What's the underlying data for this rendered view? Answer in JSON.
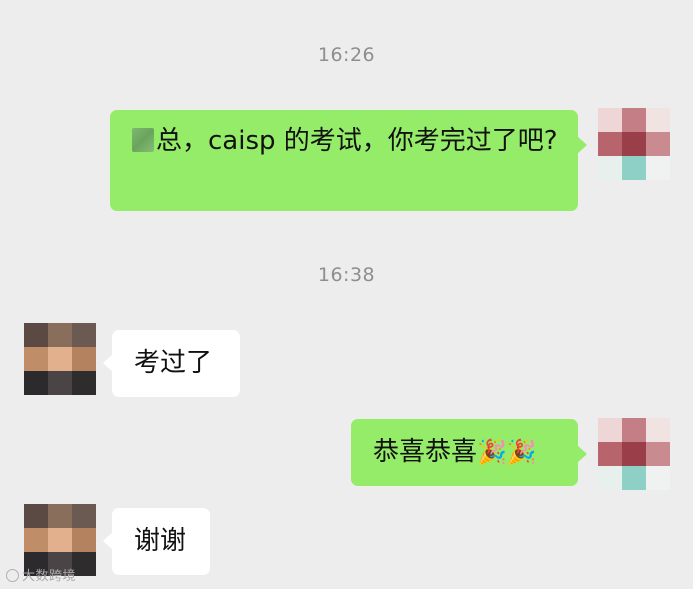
{
  "messages": [
    {
      "type": "time",
      "text": "16:26"
    },
    {
      "type": "outgoing",
      "redacted_prefix": true,
      "text": "总，caisp 的考试，你考完过了吧?"
    },
    {
      "type": "time",
      "text": "16:38"
    },
    {
      "type": "incoming",
      "text": "考过了"
    },
    {
      "type": "outgoing",
      "text": "恭喜恭喜",
      "emoji": "🎉🎉",
      "emoji_names": [
        "party-popper-icon",
        "party-popper-icon"
      ]
    },
    {
      "type": "incoming",
      "text": "谢谢"
    }
  ],
  "watermark": {
    "text": "大数跨境",
    "icon": "watermark-logo-icon"
  },
  "colors": {
    "background": "#ededed",
    "outgoing_bubble": "#95ec69",
    "incoming_bubble": "#ffffff",
    "timestamp": "#8e8e8e",
    "text": "#111111"
  }
}
